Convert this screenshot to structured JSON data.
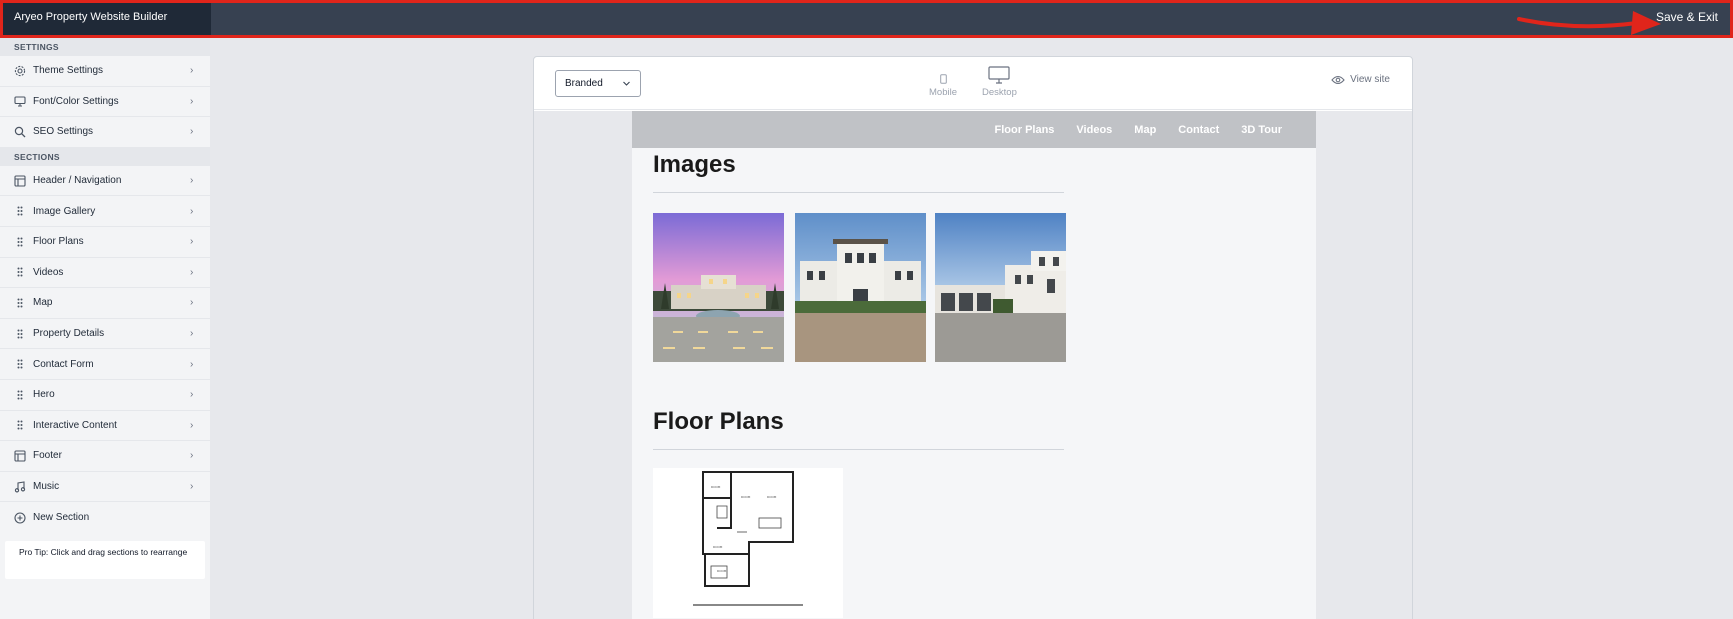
{
  "topbar": {
    "title": "Aryeo Property Website Builder",
    "save_exit": "Save & Exit"
  },
  "sidebar": {
    "settings_label": "SETTINGS",
    "settings_items": [
      {
        "label": "Theme Settings",
        "icon": "gear-icon"
      },
      {
        "label": "Font/Color Settings",
        "icon": "monitor-icon"
      },
      {
        "label": "SEO Settings",
        "icon": "search-icon"
      }
    ],
    "sections_label": "SECTIONS",
    "section_items": [
      {
        "label": "Header / Navigation",
        "icon": "layout-icon"
      },
      {
        "label": "Image Gallery",
        "icon": "drag-handle-icon"
      },
      {
        "label": "Floor Plans",
        "icon": "drag-handle-icon"
      },
      {
        "label": "Videos",
        "icon": "drag-handle-icon"
      },
      {
        "label": "Map",
        "icon": "drag-handle-icon"
      },
      {
        "label": "Property Details",
        "icon": "drag-handle-icon"
      },
      {
        "label": "Contact Form",
        "icon": "drag-handle-icon"
      },
      {
        "label": "Hero",
        "icon": "drag-handle-icon"
      },
      {
        "label": "Interactive Content",
        "icon": "drag-handle-icon"
      },
      {
        "label": "Footer",
        "icon": "layout-icon"
      },
      {
        "label": "Music",
        "icon": "music-note-icon"
      }
    ],
    "new_section": "New Section",
    "pro_tip": "Pro Tip: Click and drag sections to rearrange"
  },
  "editor": {
    "theme_select": "Branded",
    "devices": [
      "Mobile",
      "Desktop"
    ],
    "view_site": "View site"
  },
  "preview": {
    "nav": [
      "Floor Plans",
      "Videos",
      "Map",
      "Contact",
      "3D Tour"
    ],
    "images_heading": "Images",
    "floorplans_heading": "Floor Plans"
  },
  "colors": {
    "topbar": "#374151",
    "annotation": "#e0251b",
    "sidebar": "#f3f4f6"
  }
}
